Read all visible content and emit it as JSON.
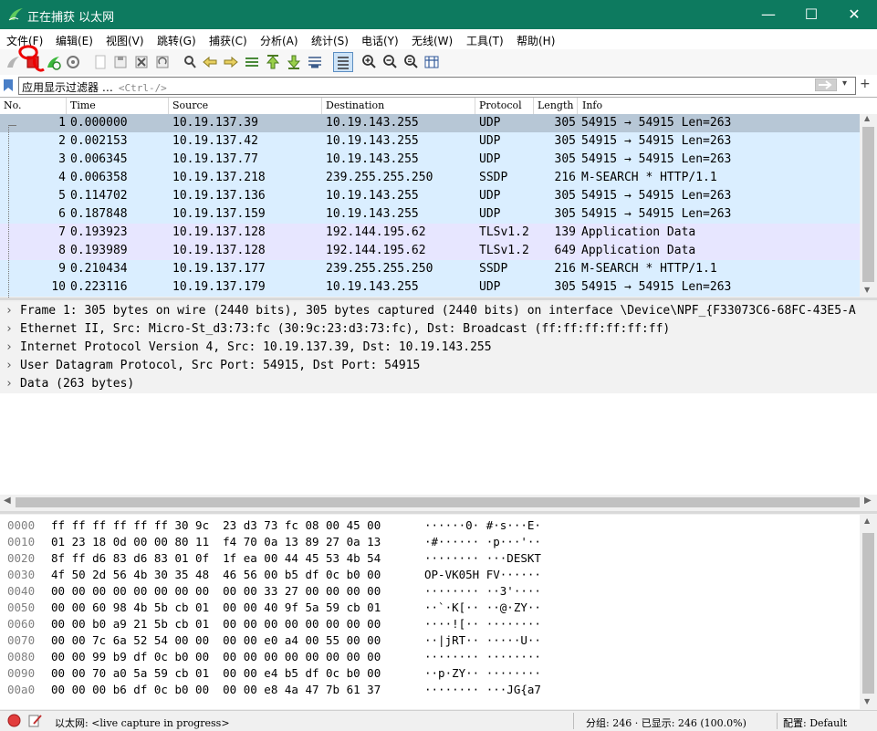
{
  "window": {
    "title": "正在捕获 以太网",
    "minimize": "—",
    "maximize": "☐",
    "close": "✕"
  },
  "menu": [
    "文件(F)",
    "编辑(E)",
    "视图(V)",
    "跳转(G)",
    "捕获(C)",
    "分析(A)",
    "统计(S)",
    "电话(Y)",
    "无线(W)",
    "工具(T)",
    "帮助(H)"
  ],
  "filter": {
    "placeholder": "应用显示过滤器 …",
    "shortcut": "<Ctrl-/>"
  },
  "columns": [
    "No.",
    "Time",
    "Source",
    "Destination",
    "Protocol",
    "Length",
    "Info"
  ],
  "packets": [
    {
      "no": "1",
      "time": "0.000000",
      "src": "10.19.137.39",
      "dst": "10.19.143.255",
      "proto": "UDP",
      "len": "305",
      "info": "54915 → 54915 Len=263"
    },
    {
      "no": "2",
      "time": "0.002153",
      "src": "10.19.137.42",
      "dst": "10.19.143.255",
      "proto": "UDP",
      "len": "305",
      "info": "54915 → 54915 Len=263"
    },
    {
      "no": "3",
      "time": "0.006345",
      "src": "10.19.137.77",
      "dst": "10.19.143.255",
      "proto": "UDP",
      "len": "305",
      "info": "54915 → 54915 Len=263"
    },
    {
      "no": "4",
      "time": "0.006358",
      "src": "10.19.137.218",
      "dst": "239.255.255.250",
      "proto": "SSDP",
      "len": "216",
      "info": "M-SEARCH * HTTP/1.1"
    },
    {
      "no": "5",
      "time": "0.114702",
      "src": "10.19.137.136",
      "dst": "10.19.143.255",
      "proto": "UDP",
      "len": "305",
      "info": "54915 → 54915 Len=263"
    },
    {
      "no": "6",
      "time": "0.187848",
      "src": "10.19.137.159",
      "dst": "10.19.143.255",
      "proto": "UDP",
      "len": "305",
      "info": "54915 → 54915 Len=263"
    },
    {
      "no": "7",
      "time": "0.193923",
      "src": "10.19.137.128",
      "dst": "192.144.195.62",
      "proto": "TLSv1.2",
      "len": "139",
      "info": "Application Data"
    },
    {
      "no": "8",
      "time": "0.193989",
      "src": "10.19.137.128",
      "dst": "192.144.195.62",
      "proto": "TLSv1.2",
      "len": "649",
      "info": "Application Data"
    },
    {
      "no": "9",
      "time": "0.210434",
      "src": "10.19.137.177",
      "dst": "239.255.255.250",
      "proto": "SSDP",
      "len": "216",
      "info": "M-SEARCH * HTTP/1.1"
    },
    {
      "no": "10",
      "time": "0.223116",
      "src": "10.19.137.179",
      "dst": "10.19.143.255",
      "proto": "UDP",
      "len": "305",
      "info": "54915 → 54915 Len=263"
    }
  ],
  "colors": {
    "udp_row": "#daeeff",
    "tls_row": "#e7e6ff",
    "selected_row": "#b7c7d6"
  },
  "details": [
    "Frame 1: 305 bytes on wire (2440 bits), 305 bytes captured (2440 bits) on interface \\Device\\NPF_{F33073C6-68FC-43E5-A",
    "Ethernet II, Src: Micro-St_d3:73:fc (30:9c:23:d3:73:fc), Dst: Broadcast (ff:ff:ff:ff:ff:ff)",
    "Internet Protocol Version 4, Src: 10.19.137.39, Dst: 10.19.143.255",
    "User Datagram Protocol, Src Port: 54915, Dst Port: 54915",
    "Data (263 bytes)"
  ],
  "hex": [
    {
      "off": "0000",
      "bytes": "ff ff ff ff ff ff 30 9c  23 d3 73 fc 08 00 45 00",
      "ascii": "······0· #·s···E·"
    },
    {
      "off": "0010",
      "bytes": "01 23 18 0d 00 00 80 11  f4 70 0a 13 89 27 0a 13",
      "ascii": "·#······ ·p···'··"
    },
    {
      "off": "0020",
      "bytes": "8f ff d6 83 d6 83 01 0f  1f ea 00 44 45 53 4b 54",
      "ascii": "········ ···DESKT"
    },
    {
      "off": "0030",
      "bytes": "4f 50 2d 56 4b 30 35 48  46 56 00 b5 df 0c b0 00",
      "ascii": "OP-VK05H FV······"
    },
    {
      "off": "0040",
      "bytes": "00 00 00 00 00 00 00 00  00 00 33 27 00 00 00 00",
      "ascii": "········ ··3'····"
    },
    {
      "off": "0050",
      "bytes": "00 00 60 98 4b 5b cb 01  00 00 40 9f 5a 59 cb 01",
      "ascii": "··`·K[·· ··@·ZY··"
    },
    {
      "off": "0060",
      "bytes": "00 00 b0 a9 21 5b cb 01  00 00 00 00 00 00 00 00",
      "ascii": "····![·· ········"
    },
    {
      "off": "0070",
      "bytes": "00 00 7c 6a 52 54 00 00  00 00 e0 a4 00 55 00 00",
      "ascii": "··|jRT·· ·····U··"
    },
    {
      "off": "0080",
      "bytes": "00 00 99 b9 df 0c b0 00  00 00 00 00 00 00 00 00",
      "ascii": "········ ········"
    },
    {
      "off": "0090",
      "bytes": "00 00 70 a0 5a 59 cb 01  00 00 e4 b5 df 0c b0 00",
      "ascii": "··p·ZY·· ········"
    },
    {
      "off": "00a0",
      "bytes": "00 00 00 b6 df 0c b0 00  00 00 e8 4a 47 7b 61 37",
      "ascii": "········ ···JG{a7"
    }
  ],
  "status": {
    "interface": "以太网: <live capture in progress>",
    "packets": "分组: 246 · 已显示: 246 (100.0%)",
    "profile": "配置: Default"
  }
}
